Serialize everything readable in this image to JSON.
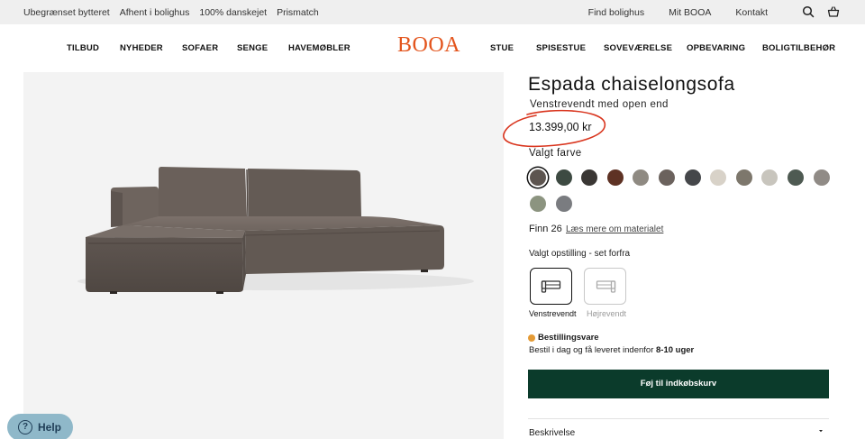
{
  "topbar": {
    "left_links": [
      "Ubegrænset bytteret",
      "Afhent i bolighus",
      "100% danskejet",
      "Prismatch"
    ],
    "right_links": [
      "Find bolighus",
      "Mit BOOA",
      "Kontakt"
    ],
    "icons": [
      "search-icon",
      "basket-icon"
    ]
  },
  "nav": {
    "logo": "BOOA",
    "left_items": [
      "TILBUD",
      "NYHEDER",
      "SOFAER",
      "SENGE",
      "HAVEMØBLER"
    ],
    "right_items": [
      "STUE",
      "SPISESTUE",
      "SOVEVÆRELSE",
      "OPBEVARING",
      "BOLIGTILBEHØR"
    ]
  },
  "product": {
    "title": "Espada chaiselongsofa",
    "subtitle": "Venstrevendt med open end",
    "price": "13.399,00 kr",
    "color_label": "Valgt farve",
    "swatch_colors": [
      "#5d5550",
      "#3d4a42",
      "#3a3734",
      "#5e3224",
      "#8f8a82",
      "#6b625d",
      "#45474a",
      "#d8d2c8",
      "#7d776c",
      "#c8c5bd",
      "#4e5a52",
      "#908b86",
      "#8c9480",
      "#7a7c80"
    ],
    "selected_swatch": 0,
    "fabric_name": "Finn 26",
    "fabric_link": "Læs mere om materialet",
    "layout_label": "Valgt opstilling - set forfra",
    "layout_options": [
      {
        "label": "Venstrevendt",
        "selected": true
      },
      {
        "label": "Højrevendt",
        "selected": false
      }
    ],
    "order_status": "Bestillingsvare",
    "order_text": "Bestil i dag og få leveret indenfor",
    "order_weeks": "8-10 uger",
    "cart_button": "Føj til indkøbskurv",
    "description_label": "Beskrivelse"
  },
  "help": {
    "label": "Help"
  },
  "colors": {
    "accent": "#e3541c",
    "cart": "#0b3b2b",
    "status_dot": "#e49a35",
    "annotation": "#d9351e"
  }
}
